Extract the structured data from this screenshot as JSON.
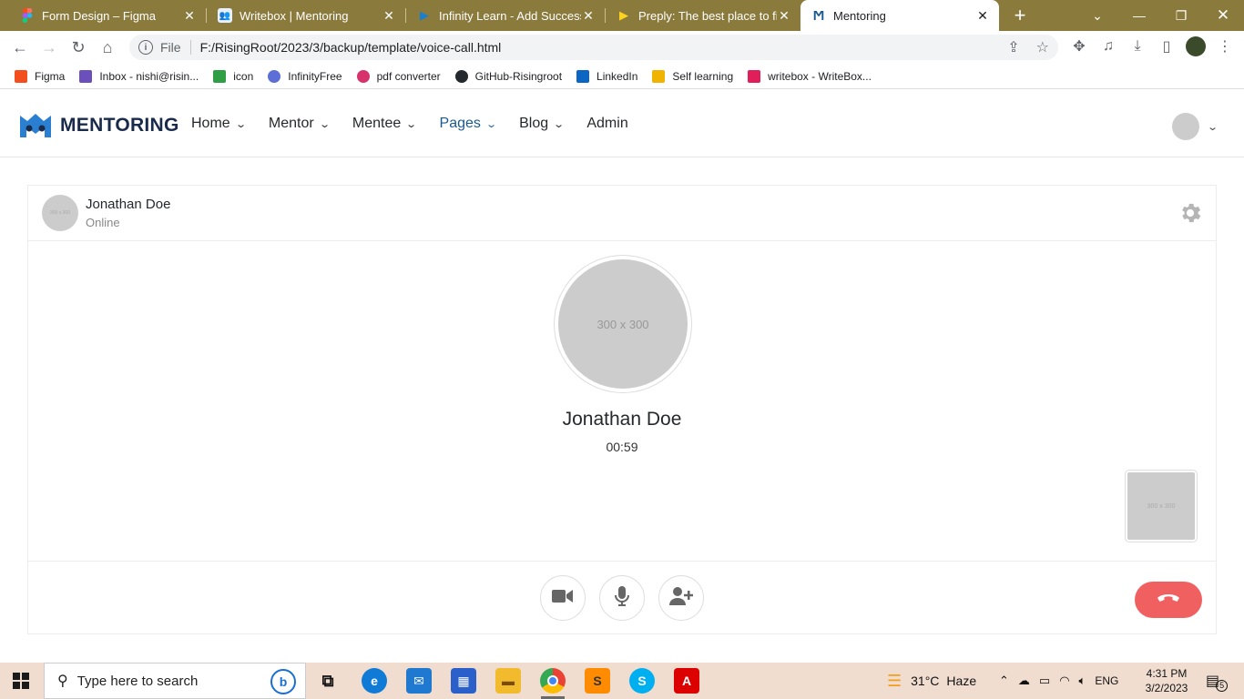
{
  "browser": {
    "tabs": [
      {
        "title": "Form Design – Figma",
        "icon": "figma-icon"
      },
      {
        "title": "Writebox | Mentoring",
        "icon": "writebox-icon"
      },
      {
        "title": "Infinity Learn - Add Success t",
        "icon": "infinity-learn-icon"
      },
      {
        "title": "Preply: The best place to find",
        "icon": "preply-icon"
      },
      {
        "title": "Mentoring",
        "icon": "mentoring-icon",
        "active": true
      }
    ],
    "address": {
      "scheme": "File",
      "url": "F:/RisingRoot/2023/3/backup/template/voice-call.html"
    },
    "bookmarks": [
      {
        "label": "Figma",
        "color": "#f24e1e"
      },
      {
        "label": "Inbox - nishi@risin...",
        "color": "#6b4fbb"
      },
      {
        "label": "icon",
        "color": "#2f9e44"
      },
      {
        "label": "InfinityFree",
        "color": "#5b6fd6"
      },
      {
        "label": "pdf converter",
        "color": "#d6336c"
      },
      {
        "label": "GitHub-Risingroot",
        "color": "#24292e"
      },
      {
        "label": "LinkedIn",
        "color": "#0a66c2"
      },
      {
        "label": "Self learning",
        "color": "#f0b400"
      },
      {
        "label": "writebox - WriteBox...",
        "color": "#e01e5a"
      }
    ]
  },
  "site": {
    "logo_text": "MENTORING",
    "nav": [
      {
        "label": "Home",
        "has_dropdown": true
      },
      {
        "label": "Mentor",
        "has_dropdown": true
      },
      {
        "label": "Mentee",
        "has_dropdown": true
      },
      {
        "label": "Pages",
        "has_dropdown": true,
        "active": true
      },
      {
        "label": "Blog",
        "has_dropdown": true
      },
      {
        "label": "Admin",
        "has_dropdown": false
      }
    ],
    "accent_color": "#1b5a90"
  },
  "call": {
    "header": {
      "name": "Jonathan Doe",
      "status": "Online",
      "avatar_placeholder": "300 x 300"
    },
    "callee": {
      "avatar_placeholder": "300 x 300",
      "name": "Jonathan Doe",
      "timer": "00:59"
    },
    "self_preview_placeholder": "300 x 300",
    "controls": [
      {
        "name": "video-camera-icon"
      },
      {
        "name": "microphone-icon"
      },
      {
        "name": "add-user-icon"
      }
    ],
    "end_call_color": "#f06060"
  },
  "taskbar": {
    "search_placeholder": "Type here to search",
    "weather_temp": "31°C",
    "weather_desc": "Haze",
    "language": "ENG",
    "time": "4:31 PM",
    "date": "3/2/2023",
    "notification_count": "5"
  }
}
